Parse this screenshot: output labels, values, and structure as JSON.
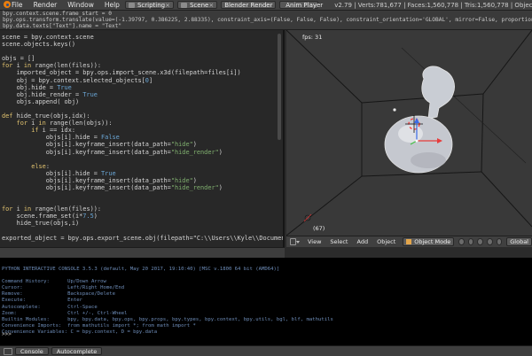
{
  "header": {
    "menus": [
      "File",
      "Render",
      "Window",
      "Help"
    ],
    "layout": "Scripting",
    "scene": "Scene",
    "engine": "Blender Render",
    "anim_player": "Anim Player",
    "stats": "v2.79 | Verts:781,677 | Faces:1,560,778 | Tris:1,560,778 | Objects:2..."
  },
  "info_log": {
    "lines": [
      "bpy.context.scene.frame_start = 0",
      "bpy.ops.transform.translate(value=(-1.39797, 0.386225, 2.88335), constraint_axis=(False, False, False), constraint_orientation='GLOBAL', mirror=False, proportional='DISABLED', proportional_edit_fa",
      "bpy.data.texts[\"Text\"].name = \"Text\""
    ]
  },
  "text_editor": {
    "lines": [
      "scene = bpy.context.scene",
      "scene.objects.keys()",
      "",
      "objs = []",
      "for i in range(len(files)):",
      "    imported_object = bpy.ops.import_scene.x3d(filepath=files[i])",
      "    obj = bpy.context.selected_objects[0]",
      "    obj.hide = True",
      "    obj.hide_render = True",
      "    objs.append( obj)",
      "",
      "def hide_true(objs,idx):",
      "    for i in range(len(objs)):",
      "        if i == idx:",
      "            objs[i].hide = False",
      "            objs[i].keyframe_insert(data_path=\"hide\")",
      "            objs[i].keyframe_insert(data_path=\"hide_render\")",
      "",
      "        else:",
      "            objs[i].hide = True",
      "            objs[i].keyframe_insert(data_path=\"hide\")",
      "            objs[i].keyframe_insert(data_path=\"hide_render\")",
      "",
      "",
      "for i in range(len(files)):",
      "    scene.frame_set(i*7.5)",
      "    hide_true(objs,i)",
      "",
      "exported_object = bpy.ops.export_scene.obj(filepath=\"C:\\\\Users\\\\Kyle\\\\Documents\\\\Unity Pr"
    ]
  },
  "viewport": {
    "fps": "fps: 31",
    "frame": "(67)",
    "menus": [
      "View",
      "Select",
      "Add",
      "Object"
    ],
    "mode": "Object Mode",
    "orientation": "Global"
  },
  "console": {
    "lines": [
      "PYTHON INTERACTIVE CONSOLE 3.5.3 (default, May 20 2017, 19:10:40) [MSC v.1800 64 bit (AMD64)]",
      "",
      "Command History:      Up/Down Arrow",
      "Cursor:               Left/Right Home/End",
      "Remove:               Backspace/Delete",
      "Execute:              Enter",
      "Autocomplete:         Ctrl-Space",
      "Zoom:                 Ctrl +/-, Ctrl-Wheel",
      "Builtin Modules:      bpy, bpy.data, bpy.ops, bpy.props, bpy.types, bpy.context, bpy.utils, bgl, blf, mathutils",
      "Convenience Imports:  from mathutils import *; from math import *",
      "Convenience Variables: C = bpy.context, D = bpy.data"
    ],
    "prompt": ">>> "
  },
  "console_footer": {
    "console_label": "Console",
    "autocomplete_label": "Autocomplete"
  }
}
